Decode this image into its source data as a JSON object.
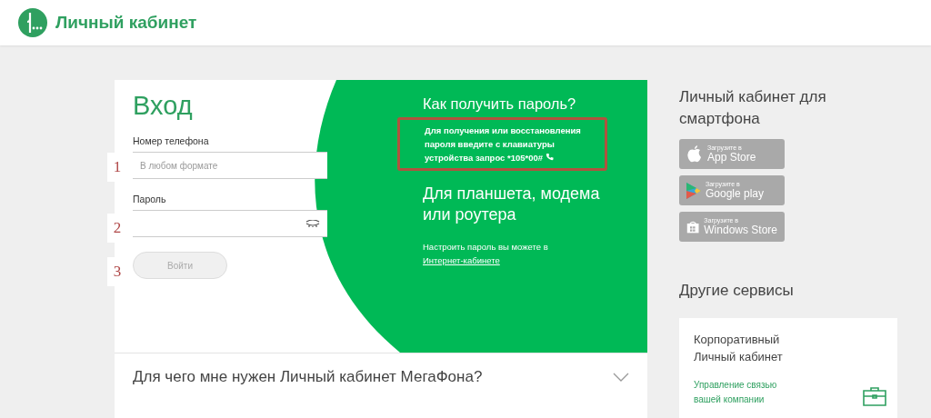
{
  "header": {
    "title": "Личный кабинет"
  },
  "login": {
    "title": "Вход",
    "fields": [
      {
        "label": "Номер телефона",
        "placeholder": "В любом формате",
        "kind": "text",
        "marker": "1"
      },
      {
        "label": "Пароль",
        "kind": "password",
        "marker": "2"
      }
    ],
    "button": {
      "label": "Войти",
      "disabled": true,
      "marker": "3"
    }
  },
  "help": {
    "heading": "Как получить пароль?",
    "text": "Для получения или восстановления пароля введите с клавиатуры устройства запрос *105*00#",
    "highlighted": true,
    "heading2": "Для планшета, модема или роутера",
    "text2": "Настроить пароль вы можете в",
    "link": "Интернет-кабинете"
  },
  "faq": {
    "question": "Для чего мне нужен Личный кабинет МегаФона?",
    "expanded": false
  },
  "apps": {
    "heading": "Личный кабинет для смартфона",
    "badges": [
      {
        "kind": "apple",
        "caption": "Загрузите в",
        "store": "App Store"
      },
      {
        "kind": "google",
        "caption": "Загрузите в",
        "store": "Google play"
      },
      {
        "kind": "windows",
        "caption": "Загрузите в",
        "store": "Windows Store"
      }
    ]
  },
  "services": {
    "heading": "Другие сервисы",
    "card": {
      "title": "Корпоративный Личный кабинет",
      "link": "Управление связью вашей компании"
    }
  }
}
